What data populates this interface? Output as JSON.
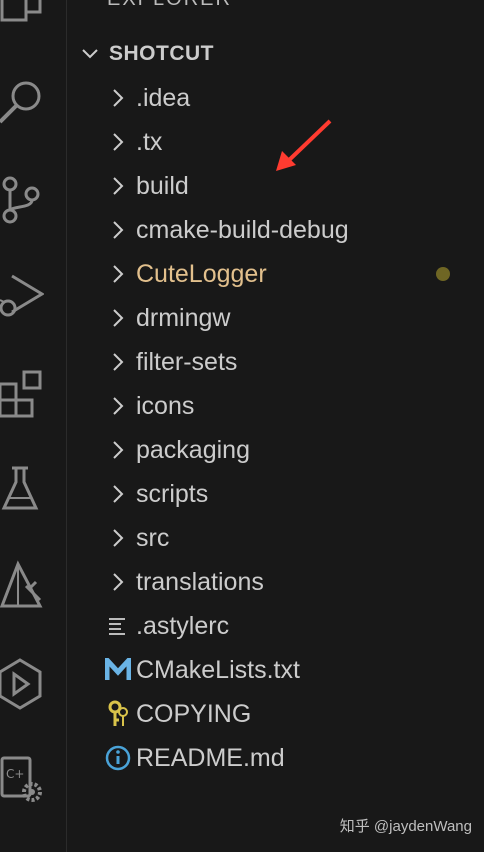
{
  "explorer": {
    "header": "EXPLORER",
    "section_title": "SHOTCUT",
    "items": [
      {
        "label": ".idea",
        "kind": "folder",
        "icon": "chevron-right-icon"
      },
      {
        "label": ".tx",
        "kind": "folder",
        "icon": "chevron-right-icon"
      },
      {
        "label": "build",
        "kind": "folder",
        "icon": "chevron-right-icon"
      },
      {
        "label": "cmake-build-debug",
        "kind": "folder",
        "icon": "chevron-right-icon"
      },
      {
        "label": "CuteLogger",
        "kind": "folder",
        "icon": "chevron-right-icon",
        "modified": true
      },
      {
        "label": "drmingw",
        "kind": "folder",
        "icon": "chevron-right-icon"
      },
      {
        "label": "filter-sets",
        "kind": "folder",
        "icon": "chevron-right-icon"
      },
      {
        "label": "icons",
        "kind": "folder",
        "icon": "chevron-right-icon"
      },
      {
        "label": "packaging",
        "kind": "folder",
        "icon": "chevron-right-icon"
      },
      {
        "label": "scripts",
        "kind": "folder",
        "icon": "chevron-right-icon"
      },
      {
        "label": "src",
        "kind": "folder",
        "icon": "chevron-right-icon"
      },
      {
        "label": "translations",
        "kind": "folder",
        "icon": "chevron-right-icon"
      },
      {
        "label": ".astylerc",
        "kind": "file",
        "icon": "lines-file-icon"
      },
      {
        "label": "CMakeLists.txt",
        "kind": "file",
        "icon": "cmake-m-icon"
      },
      {
        "label": "COPYING",
        "kind": "file",
        "icon": "license-key-icon"
      },
      {
        "label": "README.md",
        "kind": "file",
        "icon": "info-icon"
      }
    ]
  },
  "activity_bar": [
    "files-icon",
    "search-icon",
    "source-control-icon",
    "run-debug-icon",
    "extensions-icon",
    "testing-flask-icon",
    "cmake-tools-icon",
    "remote-explorer-icon",
    "cpp-settings-icon"
  ],
  "annotation": {
    "arrow_color": "#ff3b30",
    "arrow_target": "build"
  },
  "colors": {
    "modified_text": "#e2c08d",
    "modified_dot": "#6f6624",
    "cmake_icon": "#6ab4e6",
    "info_icon": "#4aa3d8",
    "key_icon": "#d9c34a"
  },
  "watermark": "知乎 @jaydenWang"
}
